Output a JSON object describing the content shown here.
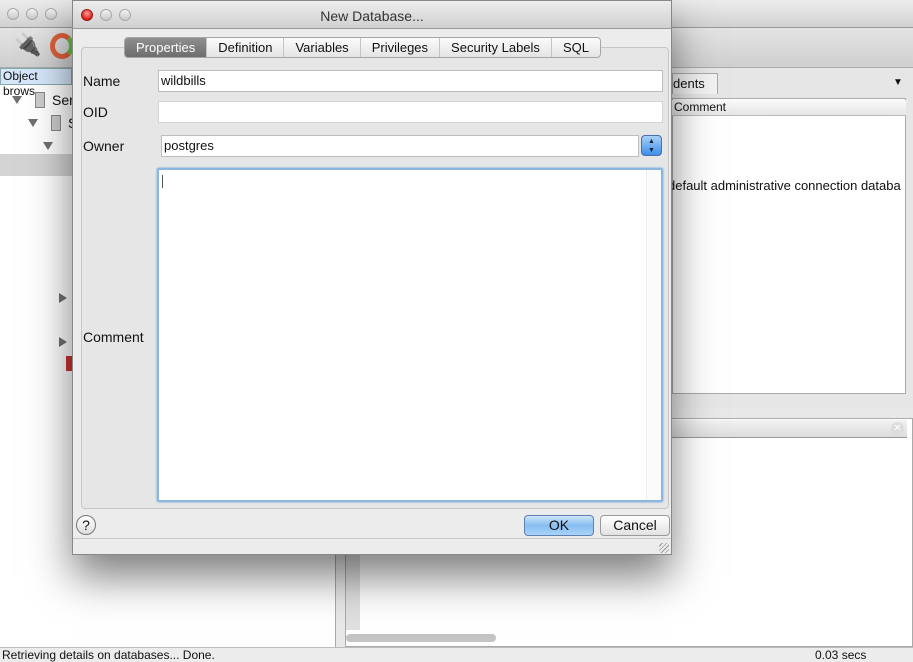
{
  "app": {
    "object_browser_tab": "Object brows",
    "tree": [
      {
        "label": "Ser"
      },
      {
        "label": "S"
      }
    ],
    "right_tab": "dents",
    "column_header": "Comment",
    "row_text": "default administrative connection databa",
    "status_text": "Retrieving details on databases... Done.",
    "status_time": "0.03 secs"
  },
  "dialog": {
    "title": "New Database...",
    "tabs": [
      {
        "label": "Properties",
        "active": true
      },
      {
        "label": "Definition"
      },
      {
        "label": "Variables"
      },
      {
        "label": "Privileges"
      },
      {
        "label": "Security Labels"
      },
      {
        "label": "SQL"
      }
    ],
    "fields": {
      "name_label": "Name",
      "name_value": "wildbills",
      "oid_label": "OID",
      "oid_value": "",
      "owner_label": "Owner",
      "owner_value": "postgres",
      "comment_label": "Comment",
      "comment_value": ""
    },
    "help_label": "?",
    "ok_label": "OK",
    "cancel_label": "Cancel"
  }
}
